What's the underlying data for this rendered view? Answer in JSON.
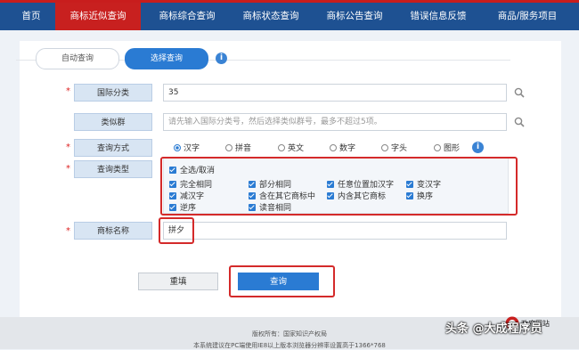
{
  "nav": {
    "tabs": [
      "首页",
      "商标近似查询",
      "商标综合查询",
      "商标状态查询",
      "商标公告查询",
      "错误信息反馈",
      "商品/服务项目"
    ]
  },
  "mode": {
    "auto": "自动查询",
    "select": "选择查询"
  },
  "fields": {
    "class_label": "国际分类",
    "class_value": "35",
    "group_label": "类似群",
    "group_placeholder": "请先输入国际分类号，然后选择类似群号，最多不超过5项。",
    "method_label": "查询方式",
    "methods": [
      "汉字",
      "拼音",
      "英文",
      "数字",
      "字头",
      "图形"
    ],
    "method_selected": "汉字",
    "type_label": "查询类型",
    "select_all": "全选/取消",
    "types_row1": [
      "完全相同",
      "部分相同",
      "任意位置加汉字",
      "变汉字"
    ],
    "types_row2": [
      "减汉字",
      "含在其它商标中",
      "内含其它商标",
      "换序"
    ],
    "types_row3": [
      "逆序",
      "读音相同"
    ],
    "name_label": "商标名称",
    "name_value": "拼夕"
  },
  "buttons": {
    "reset": "重填",
    "search": "查询"
  },
  "footer": {
    "copyright": "版权所有：国家知识产权局",
    "notice": "本系统建议在PC端使用IE8以上版本浏览器分辨率设置高于1366*768"
  },
  "watermark": {
    "text": "头条 @大成程序员",
    "seal": "政府网站"
  },
  "colors": {
    "nav_bg": "#1e5192",
    "nav_active": "#c8201f",
    "accent": "#2a7bd3",
    "highlight": "#d42a2a"
  }
}
